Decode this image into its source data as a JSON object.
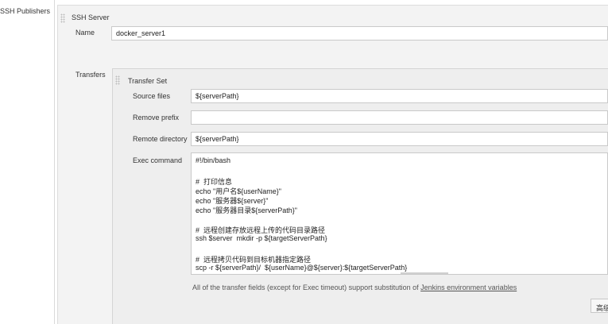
{
  "left_nav": {
    "label": "SSH Publishers"
  },
  "server": {
    "title": "SSH Server",
    "name_label": "Name",
    "name_value": "docker_server1"
  },
  "transfers": {
    "label": "Transfers",
    "set_title": "Transfer Set",
    "source_files_label": "Source files",
    "source_files_value": "${serverPath}",
    "remove_prefix_label": "Remove prefix",
    "remove_prefix_value": "",
    "remote_directory_label": "Remote directory",
    "remote_directory_value": "${serverPath}",
    "exec_command_label": "Exec command",
    "exec_lines": [
      "#!/bin/bash",
      "",
      "#  打印信息",
      "echo \"用户名${userName}\"",
      "echo \"服务器${server}\"",
      "echo \"服务器目录${serverPath}\"",
      "",
      "#  远程创建存放远程上传的代码目录路径",
      "ssh $server  mkdir -p ${targetServerPath}",
      "",
      "#  远程拷贝代码到目标机器指定路径",
      "scp -r ${serverPath}/  ${userName}@${server}:${targetServerPath}"
    ],
    "help_prefix": "All of the transfer fields (except for Exec timeout) support substitution of ",
    "help_link": "Jenkins environment variables",
    "advanced_button": "高级"
  }
}
